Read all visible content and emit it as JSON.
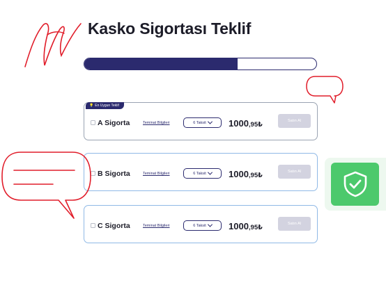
{
  "page": {
    "title": "Kasko Sigortası Teklif"
  },
  "progress": {
    "fraction": 0.66,
    "color": "#2b2a6e"
  },
  "colors": {
    "accent": "#2b2a6e",
    "annotation": "#e11d2a",
    "success": "#4cc96c",
    "disabled": "#d3d3e0"
  },
  "badge": {
    "label": "En Uygun Teklif",
    "icon": "lightbulb-icon"
  },
  "offers": [
    {
      "name": "A Sigorta",
      "link": "Teminat Bilgileri",
      "installment": "6 Taksit",
      "price_main": "1000",
      "price_dec": ",95₺",
      "buy": "Satın Al",
      "best": true
    },
    {
      "name": "B Sigorta",
      "link": "Teminat Bilgileri",
      "installment": "6 Taksit",
      "price_main": "1000",
      "price_dec": ",95₺",
      "buy": "Satın Al"
    },
    {
      "name": "C Sigorta",
      "link": "Teminat Bilgileri",
      "installment": "6 Taksit",
      "price_main": "1000",
      "price_dec": ",95₺",
      "buy": "Satın Al"
    }
  ],
  "icons": {
    "shield": "shield-check-icon",
    "bubble": "speech-bubble-icon",
    "signature": "signature-scribble"
  }
}
